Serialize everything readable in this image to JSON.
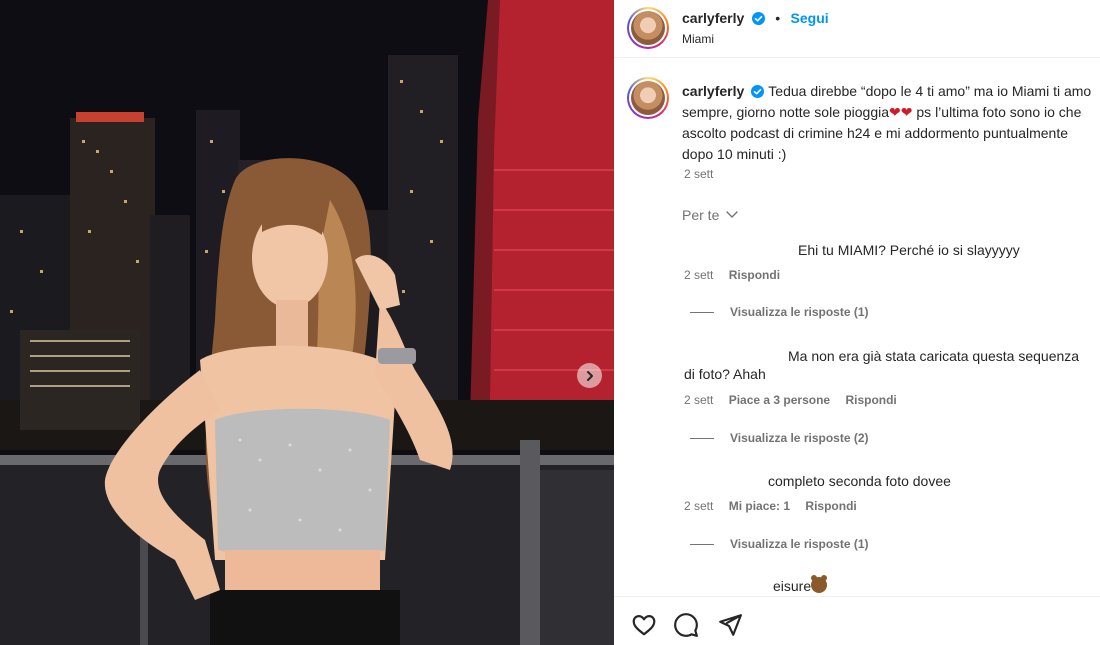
{
  "post": {
    "username": "carlyferly",
    "follow_label": "Segui",
    "separator": "•",
    "location": "Miami"
  },
  "caption": {
    "username": "carlyferly",
    "text_part1": "Tedua direbbe “dopo le 4 ti amo” ma io Miami ti amo sempre, giorno notte sole pioggia",
    "hearts": "❤❤",
    "text_part2": " ps l’ultima foto sono io che ascolto podcast di crimine h24 e mi addormento puntualmente dopo 10 minuti :)",
    "time": "2 sett"
  },
  "filter": {
    "label": "Per te"
  },
  "comments": [
    {
      "text": "Ehi tu MIAMI? Perché io si slayyyyy",
      "time": "2 sett",
      "likes": "",
      "reply": "Rispondi",
      "replies_label": "Visualizza le risposte (1)"
    },
    {
      "text": "Ma non era già stata caricata questa sequenza di foto? Ahah",
      "time": "2 sett",
      "likes": "Piace a 3 persone",
      "reply": "Rispondi",
      "replies_label": "Visualizza le risposte (2)"
    },
    {
      "text": "completo seconda foto dovee",
      "time": "2 sett",
      "likes": "Mi piace: 1",
      "reply": "Rispondi",
      "replies_label": "Visualizza le risposte (1)"
    },
    {
      "text": "eisure"
    }
  ],
  "icons": {
    "like": "heart-outline-icon",
    "comment": "comment-bubble-icon",
    "share": "paper-plane-icon",
    "verified": "verified-badge-icon",
    "next": "chevron-right-icon"
  },
  "colors": {
    "accent": "#0095f6",
    "muted": "#737373",
    "text": "#262626",
    "verified": "#0095f6"
  }
}
